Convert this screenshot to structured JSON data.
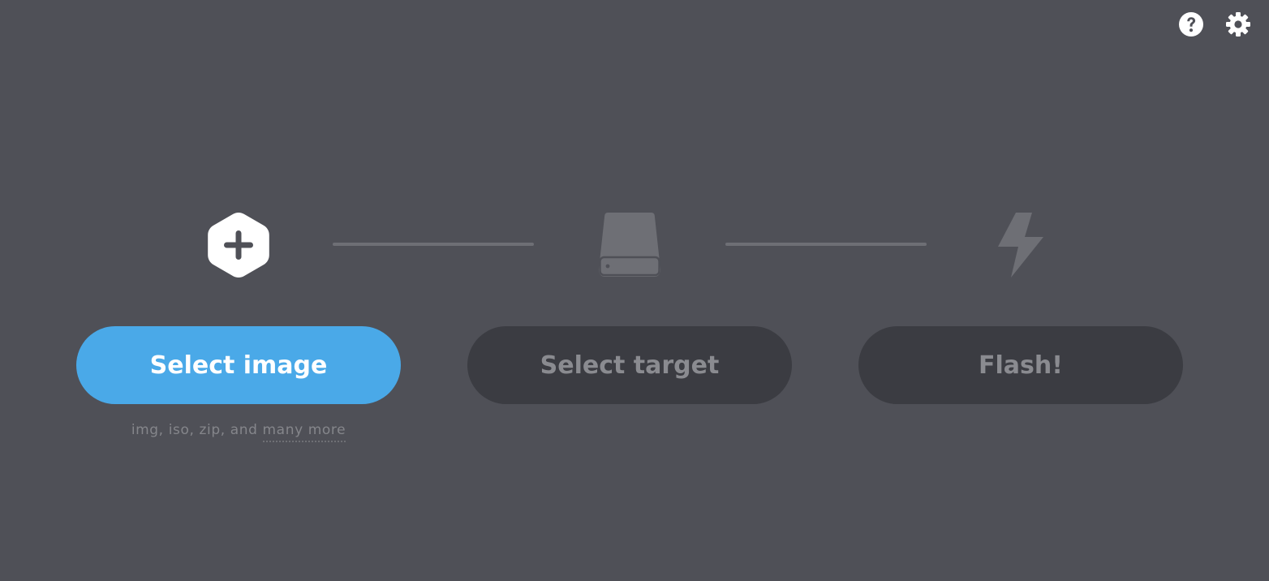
{
  "header": {
    "icons": [
      "help-icon",
      "settings-icon"
    ]
  },
  "steps": [
    {
      "icon": "plus-hexagon-icon",
      "button_label": "Select image",
      "active": true
    },
    {
      "icon": "drive-icon",
      "button_label": "Select target",
      "active": false
    },
    {
      "icon": "lightning-bolt-icon",
      "button_label": "Flash!",
      "active": false
    }
  ],
  "image_step": {
    "formats_prefix": "img, iso, zip, and ",
    "formats_link": "many more"
  },
  "colors": {
    "background": "#4f5057",
    "accent": "#4aa9e8",
    "disabled_button": "#3b3c42",
    "disabled_text": "#8a8b90",
    "connector": "#6e6f75"
  }
}
